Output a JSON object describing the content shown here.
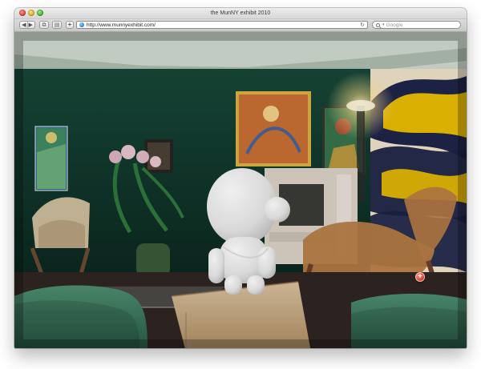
{
  "window": {
    "title": "the MunNY exhibit 2010"
  },
  "toolbar": {
    "back_label": "◀",
    "forward_label": "▶",
    "screenshot_label": "⧉",
    "reader_label": "▤",
    "add_label": "+"
  },
  "address_bar": {
    "url": "http://www.munnyexhibit.com/",
    "reload_symbol": "↻"
  },
  "search": {
    "placeholder": "Google",
    "menu_arrow": "▾"
  },
  "content": {
    "lightbox_button_symbol": "+"
  },
  "icons": {
    "window_controls": [
      "close-icon",
      "minimize-icon",
      "zoom-icon"
    ],
    "site": "globe-icon",
    "search": "search-icon",
    "lightbox": "plus-circle-icon"
  },
  "colors": {
    "room_wall": "#143f33",
    "ceiling": "#c9d2c8",
    "accent_red": "#d63b2a",
    "mural_yellow": "#f2c200",
    "mural_navy": "#1a2146"
  }
}
